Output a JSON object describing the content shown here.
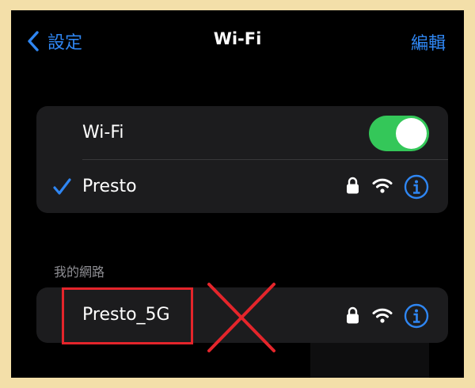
{
  "nav": {
    "back_label": "設定",
    "title": "Wi-Fi",
    "edit_label": "編輯"
  },
  "wifi_card": {
    "toggle_label": "Wi-Fi",
    "toggle_on": true,
    "connected_network": "Presto"
  },
  "my_networks": {
    "section_label": "我的網路",
    "network_name": "Presto_5G"
  },
  "overlay_text": "",
  "colors": {
    "accent": "#2f86f2",
    "toggle_on": "#34c759",
    "annotation": "#e4252b",
    "frame": "#f3dfa9"
  },
  "icons": [
    "chevron-left-icon",
    "checkmark-icon",
    "lock-icon",
    "wifi-icon",
    "info-icon"
  ]
}
